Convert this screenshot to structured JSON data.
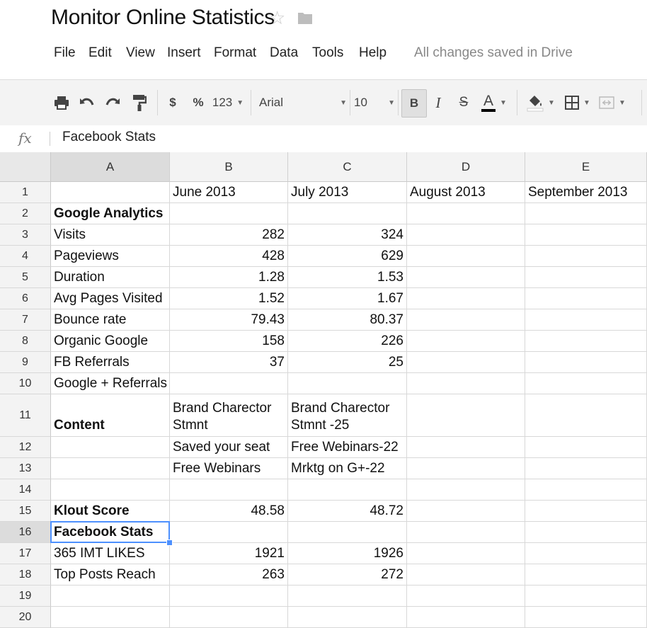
{
  "document": {
    "title": "Monitor Online Statistics",
    "star_icon": "star-outline-icon",
    "folder_icon": "folder-icon"
  },
  "menu": {
    "items": [
      "File",
      "Edit",
      "View",
      "Insert",
      "Format",
      "Data",
      "Tools",
      "Help"
    ],
    "save_status": "All changes saved in Drive"
  },
  "toolbar": {
    "print_icon": "print-icon",
    "undo_icon": "undo-icon",
    "redo_icon": "redo-icon",
    "paint_format_icon": "paint-format-icon",
    "currency_label": "$",
    "percent_label": "%",
    "number_format_label": "123",
    "font_family": "Arial",
    "font_size": "10",
    "bold_label": "B",
    "italic_label": "I",
    "strikethrough_label": "S",
    "text_color_label": "A",
    "fill_color_icon": "fill-color-icon",
    "borders_icon": "borders-icon",
    "merge_icon": "merge-cells-icon",
    "accent_color": "#4d90fe"
  },
  "formula_bar": {
    "fx_label": "fx",
    "content": "Facebook Stats"
  },
  "sheet": {
    "columns": [
      "A",
      "B",
      "C",
      "D",
      "E"
    ],
    "selected_column": "A",
    "selected_row": "16",
    "rows": [
      {
        "n": "1",
        "cells": [
          "",
          "June 2013",
          "July 2013",
          "August 2013",
          "September 2013"
        ]
      },
      {
        "n": "2",
        "cells": [
          "Google Analytics",
          "",
          "",
          "",
          ""
        ]
      },
      {
        "n": "3",
        "cells": [
          "Visits",
          "282",
          "324",
          "",
          ""
        ]
      },
      {
        "n": "4",
        "cells": [
          "Pageviews",
          "428",
          "629",
          "",
          ""
        ]
      },
      {
        "n": "5",
        "cells": [
          "Duration",
          "1.28",
          "1.53",
          "",
          ""
        ]
      },
      {
        "n": "6",
        "cells": [
          "Avg Pages Visited",
          "1.52",
          "1.67",
          "",
          ""
        ]
      },
      {
        "n": "7",
        "cells": [
          "Bounce rate",
          "79.43",
          "80.37",
          "",
          ""
        ]
      },
      {
        "n": "8",
        "cells": [
          "Organic Google",
          "158",
          "226",
          "",
          ""
        ]
      },
      {
        "n": "9",
        "cells": [
          "FB Referrals",
          "37",
          "25",
          "",
          ""
        ]
      },
      {
        "n": "10",
        "cells": [
          "Google + Referrals",
          "",
          "",
          "",
          ""
        ]
      },
      {
        "n": "11",
        "cells": [
          "Content",
          "Brand Charector Stmnt",
          "Brand Charector Stmnt -25",
          "",
          ""
        ]
      },
      {
        "n": "12",
        "cells": [
          "",
          "Saved your seat",
          "Free Webinars-22",
          "",
          ""
        ]
      },
      {
        "n": "13",
        "cells": [
          "",
          "Free Webinars",
          "Mrktg on G+-22",
          "",
          ""
        ]
      },
      {
        "n": "14",
        "cells": [
          "",
          "",
          "",
          "",
          ""
        ]
      },
      {
        "n": "15",
        "cells": [
          "Klout Score",
          "48.58",
          "48.72",
          "",
          ""
        ]
      },
      {
        "n": "16",
        "cells": [
          "Facebook Stats",
          "",
          "",
          "",
          ""
        ]
      },
      {
        "n": "17",
        "cells": [
          "365 IMT LIKES",
          "1921",
          "1926",
          "",
          ""
        ]
      },
      {
        "n": "18",
        "cells": [
          "Top Posts Reach",
          "263",
          "272",
          "",
          ""
        ]
      },
      {
        "n": "19",
        "cells": [
          "",
          "",
          "",
          "",
          ""
        ]
      },
      {
        "n": "20",
        "cells": [
          "",
          "",
          "",
          "",
          ""
        ]
      }
    ],
    "bold_rows": [
      "2",
      "11",
      "15",
      "16"
    ]
  }
}
